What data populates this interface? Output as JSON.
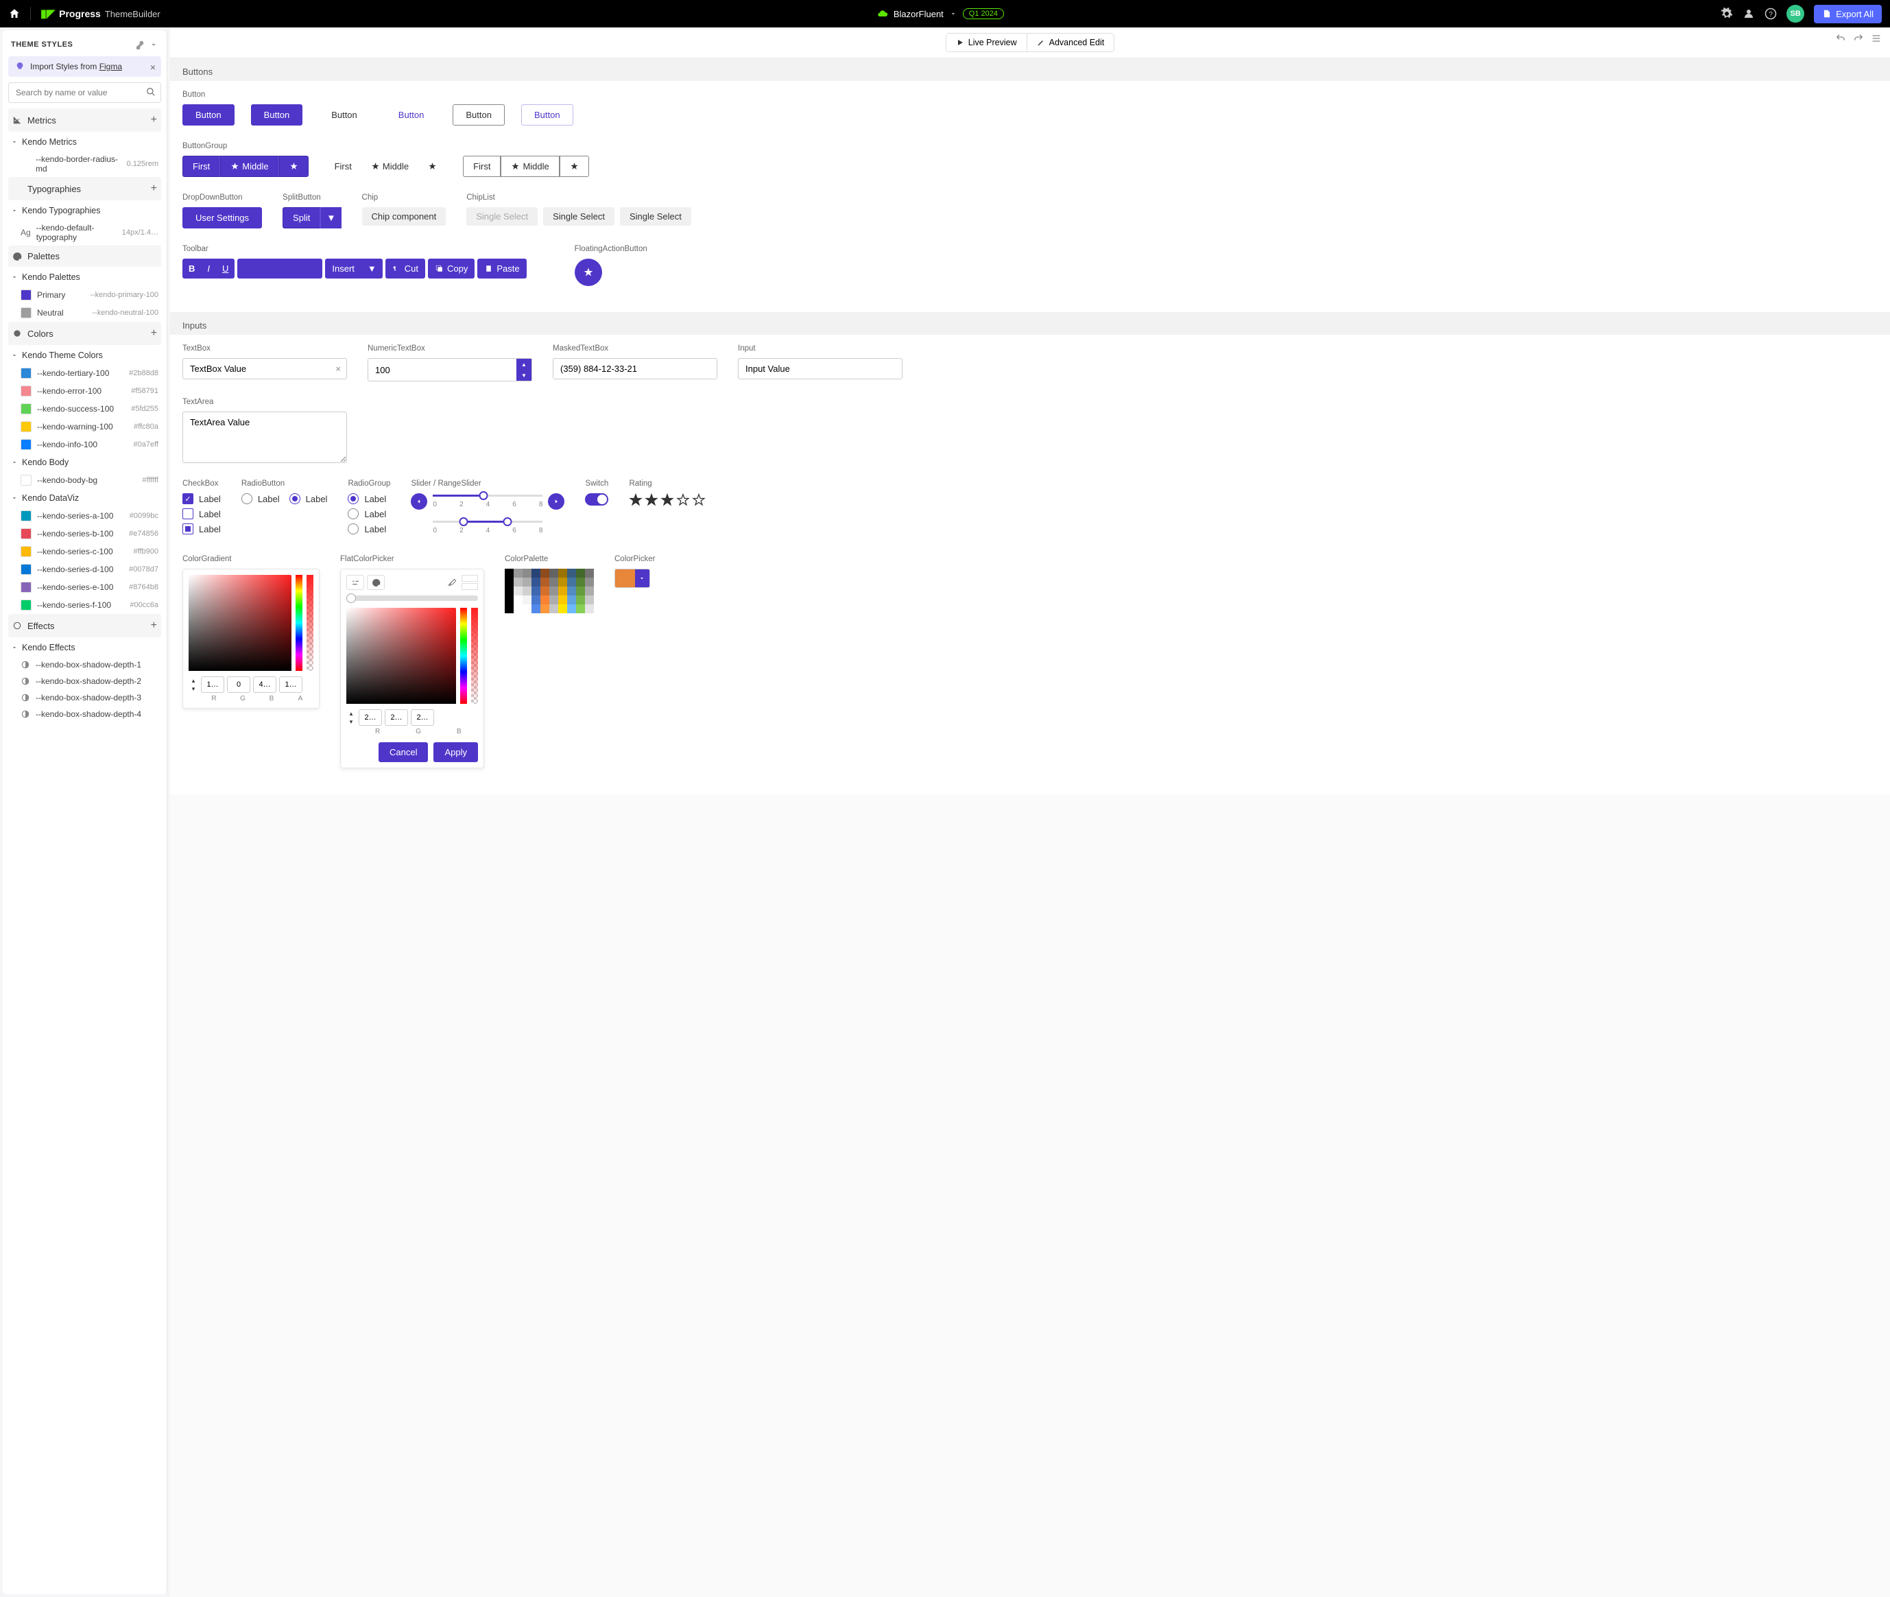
{
  "topbar": {
    "brand_progress": "Progress",
    "brand_tb": "ThemeBuilder",
    "project": "BlazorFluent",
    "release_badge": "Q1 2024",
    "avatar": "SB",
    "export_label": "Export All"
  },
  "sidebar": {
    "title": "THEME STYLES",
    "figma_pre": "Import Styles from ",
    "figma_link": "Figma",
    "search_placeholder": "Search by name or value",
    "metrics": {
      "header": "Metrics",
      "group": "Kendo Metrics",
      "items": [
        {
          "name": "--kendo-border-radius-md",
          "value": "0.125rem"
        }
      ]
    },
    "typographies": {
      "header": "Typographies",
      "group": "Kendo Typographies",
      "items": [
        {
          "name": "--kendo-default-typography",
          "value": "14px/1.4…"
        }
      ]
    },
    "palettes": {
      "header": "Palettes",
      "group": "Kendo Palettes",
      "items": [
        {
          "name": "Primary",
          "value": "--kendo-primary-100",
          "swatch": "#4f36c9"
        },
        {
          "name": "Neutral",
          "value": "--kendo-neutral-100",
          "swatch": "#9e9e9e"
        }
      ]
    },
    "colors": {
      "header": "Colors",
      "theme_group": "Kendo Theme Colors",
      "theme_items": [
        {
          "name": "--kendo-tertiary-100",
          "value": "#2b88d8",
          "swatch": "#2b88d8"
        },
        {
          "name": "--kendo-error-100",
          "value": "#f58791",
          "swatch": "#f58791"
        },
        {
          "name": "--kendo-success-100",
          "value": "#5fd255",
          "swatch": "#5fd255"
        },
        {
          "name": "--kendo-warning-100",
          "value": "#ffc80a",
          "swatch": "#ffc80a"
        },
        {
          "name": "--kendo-info-100",
          "value": "#0a7eff",
          "swatch": "#0a7eff"
        }
      ],
      "body_group": "Kendo Body",
      "body_items": [
        {
          "name": "--kendo-body-bg",
          "value": "#ffffff",
          "swatch": "#ffffff"
        }
      ],
      "dataviz_group": "Kendo DataViz",
      "dataviz_items": [
        {
          "name": "--kendo-series-a-100",
          "value": "#0099bc",
          "swatch": "#0099bc"
        },
        {
          "name": "--kendo-series-b-100",
          "value": "#e74856",
          "swatch": "#e74856"
        },
        {
          "name": "--kendo-series-c-100",
          "value": "#ffb900",
          "swatch": "#ffb900"
        },
        {
          "name": "--kendo-series-d-100",
          "value": "#0078d7",
          "swatch": "#0078d7"
        },
        {
          "name": "--kendo-series-e-100",
          "value": "#8764b8",
          "swatch": "#8764b8"
        },
        {
          "name": "--kendo-series-f-100",
          "value": "#00cc6a",
          "swatch": "#00cc6a"
        }
      ]
    },
    "effects": {
      "header": "Effects",
      "group": "Kendo Effects",
      "items": [
        {
          "name": "--kendo-box-shadow-depth-1"
        },
        {
          "name": "--kendo-box-shadow-depth-2"
        },
        {
          "name": "--kendo-box-shadow-depth-3"
        },
        {
          "name": "--kendo-box-shadow-depth-4"
        }
      ]
    }
  },
  "main": {
    "live_preview": "Live Preview",
    "advanced_edit": "Advanced Edit",
    "sections": {
      "buttons": {
        "title": "Buttons",
        "button_label": "Button",
        "button_text": "Button",
        "btngroup_label": "ButtonGroup",
        "bg_first": "First",
        "bg_middle": "Middle",
        "dropdown_label": "DropDownButton",
        "dropdown_text": "User Settings",
        "split_label": "SplitButton",
        "split_text": "Split",
        "chip_label": "Chip",
        "chip_text": "Chip component",
        "chiplist_label": "ChipList",
        "chiplist_text": "Single Select",
        "toolbar_label": "Toolbar",
        "tb_insert": "Insert",
        "tb_cut": "Cut",
        "tb_copy": "Copy",
        "tb_paste": "Paste",
        "fab_label": "FloatingActionButton"
      },
      "inputs": {
        "title": "Inputs",
        "textbox_label": "TextBox",
        "textbox_value": "TextBox Value",
        "numeric_label": "NumericTextBox",
        "numeric_value": "100",
        "masked_label": "MaskedTextBox",
        "masked_value": "(359) 884-12-33-21",
        "input_label": "Input",
        "input_value": "Input Value",
        "textarea_label": "TextArea",
        "textarea_value": "TextArea Value",
        "checkbox_label": "CheckBox",
        "chk_text": "Label",
        "radiobutton_label": "RadioButton",
        "radiogroup_label": "RadioGroup",
        "radio_text": "Label",
        "slider_label": "Slider / RangeSlider",
        "slider_ticks": [
          "0",
          "2",
          "4",
          "6",
          "8"
        ],
        "switch_label": "Switch",
        "rating_label": "Rating",
        "rating_value": 3,
        "colorgradient_label": "ColorGradient",
        "cg_r": "1…",
        "cg_g": "0",
        "cg_b": "4…",
        "cg_a": "1…",
        "cg_labels": [
          "R",
          "G",
          "B",
          "A"
        ],
        "flatpicker_label": "FlatColorPicker",
        "fp_r": "2…",
        "fp_g": "2…",
        "fp_b": "2…",
        "fp_labels": [
          "R",
          "G",
          "B"
        ],
        "fp_cancel": "Cancel",
        "fp_apply": "Apply",
        "colorpalette_label": "ColorPalette",
        "colorpicker_label": "ColorPicker"
      }
    }
  }
}
